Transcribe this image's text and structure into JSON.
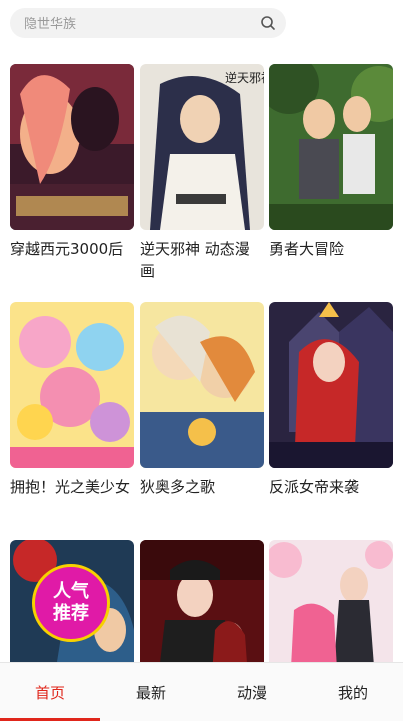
{
  "search": {
    "placeholder": "隐世华族"
  },
  "comics": [
    {
      "title": "穿越西元3000后"
    },
    {
      "title": "逆天邪神 动态漫画"
    },
    {
      "title": "勇者大冒险"
    },
    {
      "title": "拥抱！光之美少女"
    },
    {
      "title": "狄奥多之歌"
    },
    {
      "title": "反派女帝来袭"
    },
    {
      "title": ""
    },
    {
      "title": ""
    },
    {
      "title": ""
    }
  ],
  "badge": {
    "line1": "人气",
    "line2": "推荐"
  },
  "tabs": [
    {
      "label": "首页",
      "active": true
    },
    {
      "label": "最新"
    },
    {
      "label": "动漫"
    },
    {
      "label": "我的"
    }
  ],
  "colors": {
    "accent": "#e0261b",
    "badge": "#e01aa7"
  }
}
